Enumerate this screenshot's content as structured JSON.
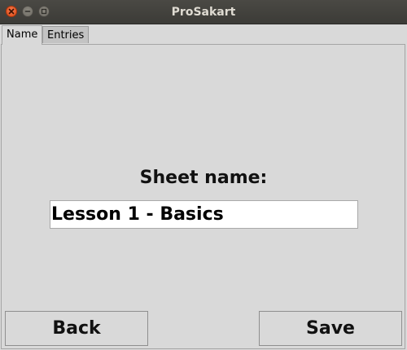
{
  "window": {
    "title": "ProSakart"
  },
  "tabs": [
    {
      "label": "Name",
      "active": true
    },
    {
      "label": "Entries",
      "active": false
    }
  ],
  "form": {
    "label": "Sheet name:",
    "value": "Lesson 1 - Basics"
  },
  "buttons": {
    "back": "Back",
    "save": "Save"
  },
  "colors": {
    "background": "#d9d9d9",
    "titlebar": "#3c3b37",
    "close_button": "#df4a16"
  }
}
